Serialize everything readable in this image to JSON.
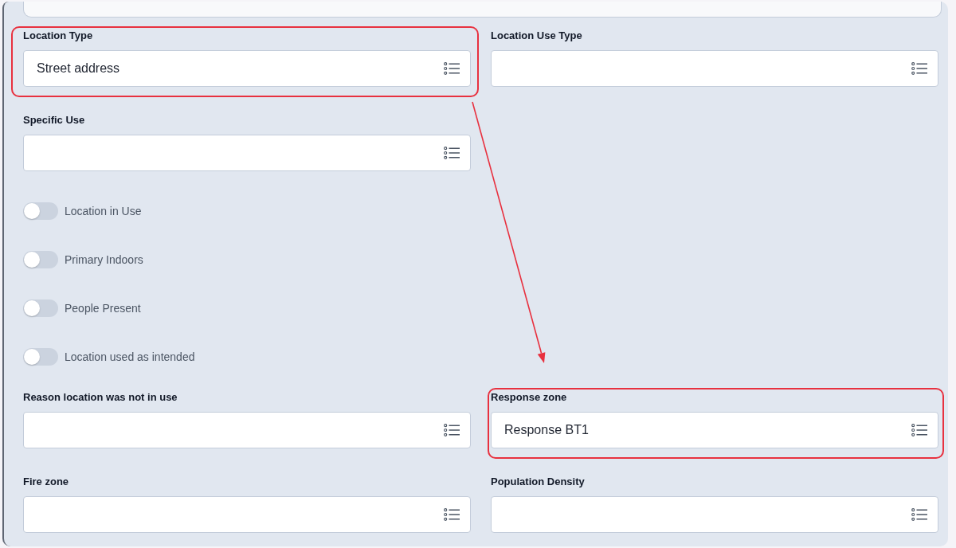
{
  "form": {
    "rows": [
      {
        "kind": "selects",
        "items": [
          {
            "label": "Location Type",
            "value": "Street address",
            "highlighted": true
          },
          {
            "label": "Location Use Type",
            "highlighted": false
          }
        ]
      },
      {
        "kind": "selects",
        "items": [
          {
            "label": "Specific Use",
            "highlighted": false
          }
        ]
      },
      {
        "kind": "toggles",
        "items": [
          {
            "label": "Location in Use",
            "on": false
          },
          {
            "label": "Primary Indoors",
            "on": false
          },
          {
            "label": "People Present",
            "on": false
          },
          {
            "label": "Location used as intended",
            "on": false
          }
        ]
      },
      {
        "kind": "selects",
        "items": [
          {
            "label": "Reason location was not in use",
            "highlighted": false
          },
          {
            "label": "Response zone",
            "value": "Response BT1",
            "highlighted": true
          }
        ]
      },
      {
        "kind": "selects",
        "items": [
          {
            "label": "Fire zone",
            "highlighted": false
          },
          {
            "label": "Population Density",
            "highlighted": false
          }
        ]
      }
    ]
  },
  "annotation_arrow": true
}
